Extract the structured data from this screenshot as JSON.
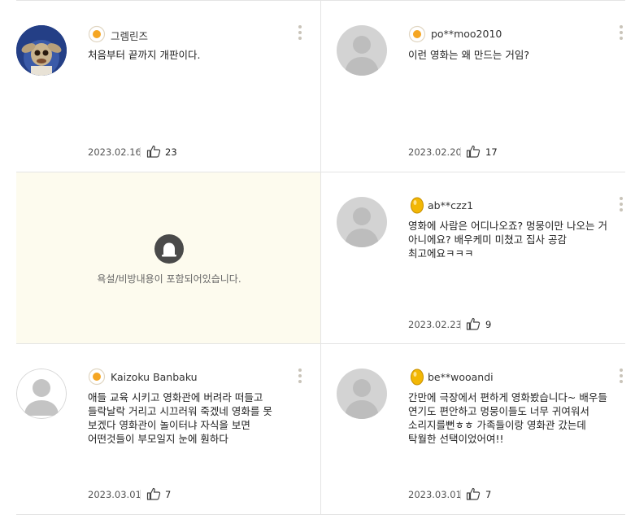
{
  "comments": [
    {
      "nickname": "그렘린즈",
      "badge": "egg-fried",
      "text": "처음부터 끝까지 개판이다.",
      "date": "2023.02.16",
      "likes": "23"
    },
    {
      "nickname": "po**moo2010",
      "badge": "egg-fried",
      "text": "이런 영화는 왜 만드는 거임?",
      "date": "2023.02.20",
      "likes": "17"
    },
    {
      "blocked": true,
      "blocked_message": "욕설/비방내용이 포함되어있습니다."
    },
    {
      "nickname": "ab**czz1",
      "badge": "egg-golden",
      "text": "영화에 사람은 어디나오죠? 멍뭉이만 나오는 거 아니에요? 배우케미 미쳤고 집사 공감 최고에요ㅋㅋㅋ",
      "date": "2023.02.23",
      "likes": "9"
    },
    {
      "nickname": "Kaizoku Banbaku",
      "badge": "egg-fried",
      "text": "애들 교육 시키고 영화관에 버려라 떠들고 들락날락 거리고 시끄러워 죽겠네 영화를 못 보겠다 영화관이 놀이터냐 자식을 보면 어떤것들이 부모일지 눈에 훤하다",
      "date": "2023.03.01",
      "likes": "7"
    },
    {
      "nickname": "be**wooandi",
      "badge": "egg-golden",
      "text": "간만에 극장에서 편하게 영화봤습니다~ 배우들 연기도 편안하고 멍뭉이들도 너무 귀여워서 소리지를뻔ㅎㅎ 가족들이랑 영화관 갔는데 탁월한 선택이었어여!!",
      "date": "2023.03.01",
      "likes": "7"
    }
  ],
  "colors": {
    "divider": "#e4e4e4",
    "blocked_bg": "#fdfbee",
    "yolk": "#f5a623",
    "golden": "#f2b705",
    "dots": "#c9c4b9"
  }
}
